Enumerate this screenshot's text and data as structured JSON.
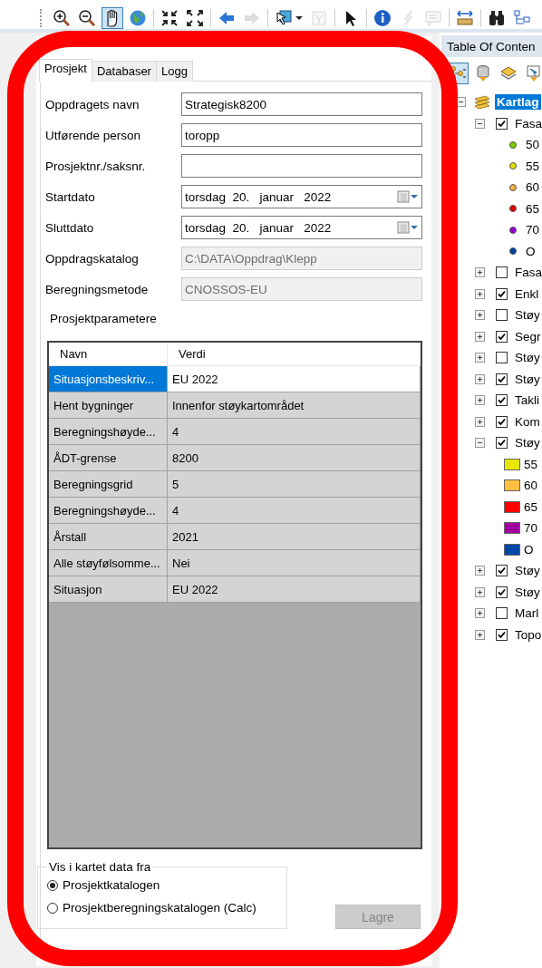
{
  "toolbar": {
    "tools": [
      {
        "kind": "zoom-in",
        "selected": false,
        "disabled": false
      },
      {
        "kind": "zoom-out",
        "selected": false,
        "disabled": false
      },
      {
        "kind": "pan",
        "selected": true,
        "disabled": false
      },
      {
        "kind": "globe",
        "selected": false,
        "disabled": false
      },
      {
        "kind": "separator"
      },
      {
        "kind": "zoom-in-fixed",
        "selected": false,
        "disabled": false
      },
      {
        "kind": "zoom-out-fixed",
        "selected": false,
        "disabled": false
      },
      {
        "kind": "separator"
      },
      {
        "kind": "back",
        "selected": false,
        "disabled": false
      },
      {
        "kind": "forward",
        "selected": false,
        "disabled": true
      },
      {
        "kind": "separator"
      },
      {
        "kind": "select-features",
        "selected": false,
        "disabled": false
      },
      {
        "kind": "clear-selection",
        "selected": false,
        "disabled": true
      },
      {
        "kind": "separator"
      },
      {
        "kind": "select-elements",
        "selected": false,
        "disabled": false
      },
      {
        "kind": "separator"
      },
      {
        "kind": "identify",
        "selected": false,
        "disabled": false
      },
      {
        "kind": "flash",
        "selected": false,
        "disabled": true
      },
      {
        "kind": "popup",
        "selected": false,
        "disabled": true
      },
      {
        "kind": "separator"
      },
      {
        "kind": "measure",
        "selected": false,
        "disabled": false
      },
      {
        "kind": "separator"
      },
      {
        "kind": "find",
        "selected": false,
        "disabled": false
      },
      {
        "kind": "diagram",
        "selected": false,
        "disabled": false
      }
    ]
  },
  "project_panel": {
    "tabs": [
      {
        "label": "Prosjekt",
        "selected": true
      },
      {
        "label": "Databaser",
        "selected": false
      },
      {
        "label": "Logg",
        "selected": false
      }
    ],
    "fields": [
      {
        "label": "Oppdragets navn",
        "kind": "text",
        "value": "Strategisk8200"
      },
      {
        "label": "Utførende person",
        "kind": "text",
        "value": "toropp"
      },
      {
        "label": "Prosjektnr./saksnr.",
        "kind": "text"
      },
      {
        "label": "Startdato",
        "kind": "date",
        "value": "torsdag  20.   januar   2022"
      },
      {
        "label": "Sluttdato",
        "kind": "date",
        "value": "torsdag  20.   januar   2022"
      },
      {
        "label": "Oppdragskatalog",
        "kind": "readonly",
        "value": "C:\\DATA\\Oppdrag\\Klepp"
      },
      {
        "label": "Beregningsmetode",
        "kind": "readonly",
        "value": "CNOSSOS-EU"
      }
    ],
    "section_label": "Prosjektparametere",
    "table": {
      "columns": [
        "Navn",
        "Verdi"
      ],
      "rows": [
        {
          "name": "Situasjonsbeskriv...",
          "value": "EU 2022",
          "selected": true
        },
        {
          "name": "Hent bygninger",
          "value": "Innenfor støykartområdet",
          "selected": false
        },
        {
          "name": "Beregningshøyde...",
          "value": "4",
          "selected": false
        },
        {
          "name": "ÅDT-grense",
          "value": "8200",
          "selected": false
        },
        {
          "name": "Beregningsgrid",
          "value": "5",
          "selected": false
        },
        {
          "name": "Beregningshøyde...",
          "value": "4",
          "selected": false
        },
        {
          "name": "Årstall",
          "value": "2021",
          "selected": false
        },
        {
          "name": "Alle støyfølsomme...",
          "value": "Nei",
          "selected": false
        },
        {
          "name": "Situasjon",
          "value": "EU 2022",
          "selected": false
        }
      ]
    },
    "map_source": {
      "title": "Vis i kartet data fra",
      "options": [
        {
          "label": "Prosjektkatalogen",
          "selected": true
        },
        {
          "label": "Prosjektberegningskatalogen (Calc)",
          "selected": false
        }
      ]
    },
    "save_button": {
      "label": "Lagre",
      "disabled": true
    }
  },
  "toc": {
    "title": "Table Of Conten",
    "tools": [
      {
        "kind": "list-order",
        "selected": true
      },
      {
        "kind": "source",
        "selected": false
      },
      {
        "kind": "visibility",
        "selected": false
      },
      {
        "kind": "selection",
        "selected": false
      }
    ],
    "tree": [
      {
        "label": "Kartlag",
        "kind": "group",
        "selected": true,
        "expanded": true,
        "children": [
          {
            "label": "Fasa",
            "kind": "layer",
            "checked": true,
            "expanded": true,
            "children": [
              {
                "label": "50",
                "kind": "point",
                "color": "#7fcc00"
              },
              {
                "label": "55",
                "kind": "point",
                "color": "#dede00"
              },
              {
                "label": "60",
                "kind": "point",
                "color": "#f0b040"
              },
              {
                "label": "65",
                "kind": "point",
                "color": "#e00000"
              },
              {
                "label": "70",
                "kind": "point",
                "color": "#9000d0"
              },
              {
                "label": "O",
                "kind": "point",
                "color": "#003d99"
              }
            ]
          },
          {
            "label": "Fasa",
            "kind": "layer",
            "checked": false,
            "expanded": false
          },
          {
            "label": "Enkl",
            "kind": "layer",
            "checked": true,
            "expanded": false
          },
          {
            "label": "Støy",
            "kind": "layer",
            "checked": false,
            "expanded": false
          },
          {
            "label": "Segr",
            "kind": "layer",
            "checked": true,
            "expanded": false
          },
          {
            "label": "Støy",
            "kind": "layer",
            "checked": false,
            "expanded": false
          },
          {
            "label": "Støy",
            "kind": "layer",
            "checked": true,
            "expanded": false
          },
          {
            "label": "Takli",
            "kind": "layer",
            "checked": true,
            "expanded": false
          },
          {
            "label": "Kom",
            "kind": "layer",
            "checked": true,
            "expanded": false
          },
          {
            "label": "Støy",
            "kind": "layer",
            "checked": true,
            "expanded": true,
            "children": [
              {
                "label": "55",
                "kind": "swatch",
                "color": "#e6e600"
              },
              {
                "label": "60",
                "kind": "swatch",
                "color": "#ffbf40"
              },
              {
                "label": "65",
                "kind": "swatch",
                "color": "#ff0000"
              },
              {
                "label": "70",
                "kind": "swatch",
                "color": "#a000a0"
              },
              {
                "label": "O",
                "kind": "swatch",
                "color": "#0047a8"
              }
            ]
          },
          {
            "label": "Støy",
            "kind": "layer",
            "checked": true,
            "expanded": false
          },
          {
            "label": "Støy",
            "kind": "layer",
            "checked": true,
            "expanded": false
          },
          {
            "label": "Marl",
            "kind": "layer",
            "checked": false,
            "expanded": false
          },
          {
            "label": "Topo",
            "kind": "layer",
            "checked": true,
            "expanded": false
          }
        ]
      }
    ]
  }
}
